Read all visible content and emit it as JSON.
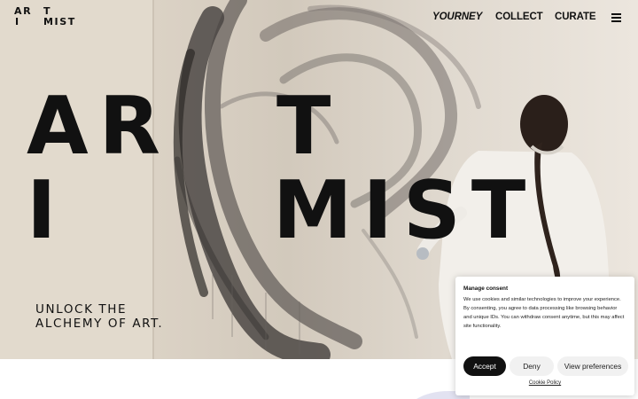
{
  "logo": {
    "line1_left": "AR",
    "line1_right": "T",
    "line2_left": "I",
    "line2_right": "MIST"
  },
  "nav": {
    "items": [
      "YOURNEY",
      "COLLECT",
      "CURATE"
    ],
    "menu_icon": "hamburger-icon"
  },
  "hero": {
    "title_row1_left": "AR",
    "title_row1_right": "T",
    "title_row2_left": "I",
    "title_row2_right": "MIST",
    "tagline_line1": "UNLOCK THE",
    "tagline_line2": "ALCHEMY OF ART."
  },
  "consent": {
    "title": "Manage consent",
    "body": "We use cookies and similar technologies to improve your experience. By consenting, you agree to data processing like browsing behavior and unique IDs. You can withdraw consent anytime, but this may affect site functionality.",
    "accept_label": "Accept",
    "deny_label": "Deny",
    "preferences_label": "View preferences",
    "policy_link": "Cookie Policy"
  },
  "colors": {
    "text": "#111111",
    "accept_bg": "#111111",
    "secondary_btn_bg": "#f1f1f1",
    "hero_bg": "#ddd4c7"
  }
}
